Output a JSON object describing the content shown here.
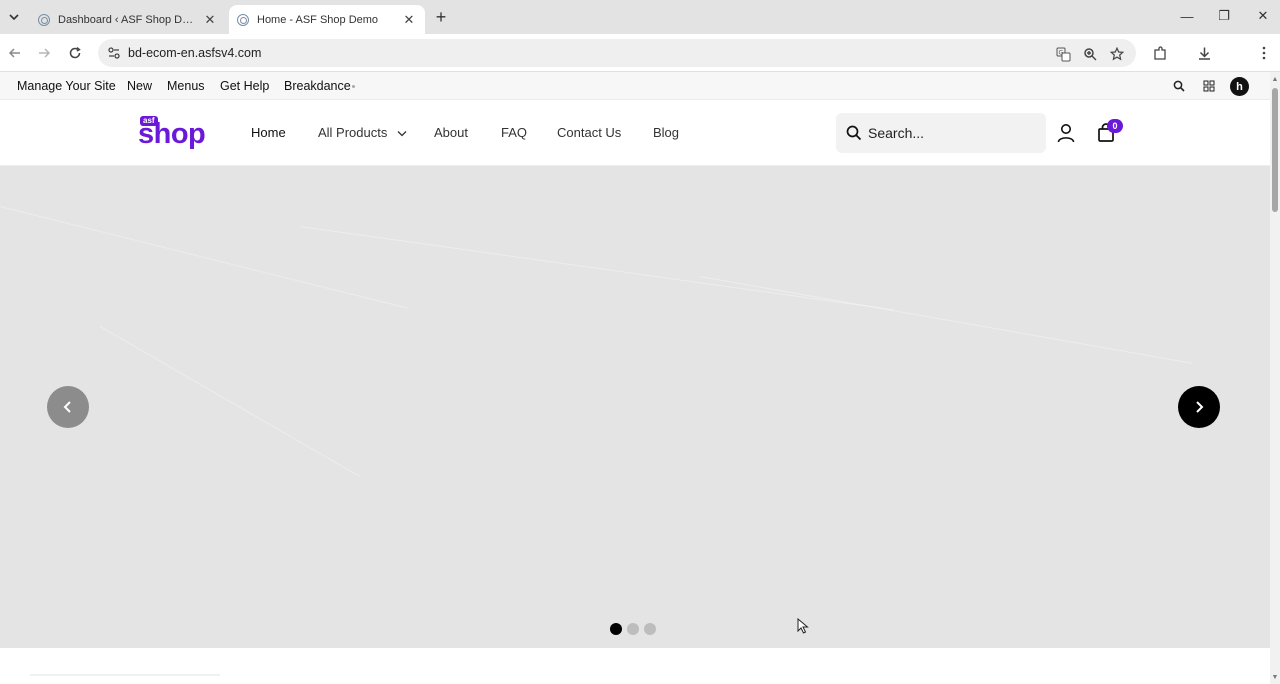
{
  "browser": {
    "tabs": [
      {
        "title": "Dashboard ‹ ASF Shop Demo — WordPress",
        "active": false
      },
      {
        "title": "Home - ASF Shop Demo",
        "active": true
      }
    ],
    "new_tab": "+",
    "tab_close": "✕",
    "url": "bd-ecom-en.asfsv4.com",
    "window_controls": {
      "minimize": "—",
      "maximize": "❐",
      "close": "✕"
    },
    "icons": [
      "back-icon",
      "forward-icon",
      "reload-icon",
      "site-info-icon",
      "translate-icon",
      "zoom-icon",
      "bookmark-star-icon",
      "extensions-icon",
      "download-icon",
      "menu-kebab-icon"
    ]
  },
  "admin_bar": {
    "items": [
      "Manage Your Site",
      "New",
      "Menus",
      "Get Help",
      "Breakdance"
    ],
    "avatar_initial": "h"
  },
  "header": {
    "logo": {
      "badge": "asf",
      "word": "shop"
    },
    "nav": [
      {
        "label": "Home",
        "active": true
      },
      {
        "label": "All Products",
        "dropdown": true
      },
      {
        "label": "About"
      },
      {
        "label": "FAQ"
      },
      {
        "label": "Contact Us"
      },
      {
        "label": "Blog"
      }
    ],
    "search_placeholder": "Search...",
    "cart_count": "0"
  },
  "hero": {
    "background": "#e4e4e4",
    "slide_count": 3,
    "active_slide": 1
  },
  "colors": {
    "brand": "#6a19d8",
    "prev_arrow": "#8c8c8c",
    "next_arrow": "#000000"
  }
}
